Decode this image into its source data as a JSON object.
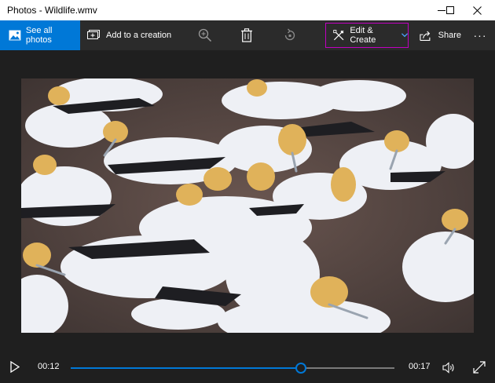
{
  "window": {
    "title": "Photos - Wildlife.wmv",
    "buttons": [
      "minimize-icon",
      "maximize-icon",
      "close-icon"
    ]
  },
  "toolbar": {
    "see_all_photos": "See all photos",
    "add_to_creation": "Add to a creation",
    "zoom": "zoom-in-icon",
    "delete": "trash-icon",
    "rotate": "rotate-icon",
    "edit_create": "Edit & Create",
    "share": "Share",
    "more": "···"
  },
  "player": {
    "elapsed": "00:12",
    "total": "00:17",
    "progress_fraction": 0.71
  },
  "colors": {
    "accent": "#0078d7",
    "highlight_border": "#c100c1",
    "background": "#1f1f1f",
    "toolbar": "#2b2b2b"
  }
}
